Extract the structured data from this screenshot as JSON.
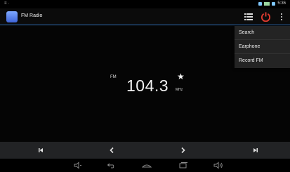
{
  "status_bar": {
    "left_text": "≡ ·",
    "time": "5:36"
  },
  "app": {
    "title": "FM Radio",
    "accent_color": "#2e6fb7",
    "power_color": "#e03a2f"
  },
  "menu": {
    "items": [
      {
        "label": "Search"
      },
      {
        "label": "Earphone"
      },
      {
        "label": "Record FM"
      }
    ]
  },
  "tuner": {
    "band": "FM",
    "frequency": "104.3",
    "unit": "MHz",
    "favorite_glyph": "★"
  },
  "controls": {
    "icons": [
      "skip-prev-icon",
      "seek-back-icon",
      "seek-forward-icon",
      "skip-next-icon"
    ]
  },
  "navigation": {
    "icons": [
      "volume-down-icon",
      "back-icon",
      "home-icon",
      "recent-apps-icon",
      "volume-up-icon"
    ]
  }
}
